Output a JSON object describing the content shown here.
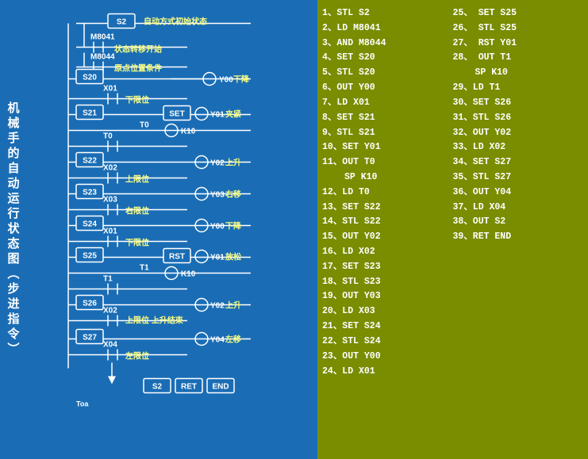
{
  "leftPanel": {
    "title": "机械手的自动运行状态图（步进指令）",
    "bgColor": "#1a6db5"
  },
  "rightPanel": {
    "bgColor": "#7a8c00",
    "col1": [
      "1、STL  S2",
      "2、LD   M8041",
      "3、AND M8044",
      "4、SET  S20",
      "5、STL  S20",
      "6、OUT  Y00",
      "7、LD   X01",
      "8、SET  S21",
      "9、STL  S21",
      "10、SET Y01",
      "11、OUT T0",
      "    SP K10",
      "12、LD  T0",
      "13、SET S22",
      "14、STL S22",
      "15、OUT Y02",
      "16、LD  X02",
      "17、SET S23",
      "18、STL S23",
      "19、OUT Y03",
      "20、LD  X03",
      "21、SET S24",
      "22、STL S24",
      "23、OUT Y00",
      "24、LD  X01"
    ],
    "col2": [
      "25、 SET S25",
      "26、 STL S25",
      "27、 RST  Y01",
      "28、 OUT  T1",
      "      SP K10",
      "29、LD  T1",
      "30、SET S26",
      "31、STL  S26",
      "32、OUT Y02",
      "33、LD    X02",
      "34、SET S27",
      "35、STL  S27",
      "36、OUT Y04",
      "37、LD  X04",
      "38、OUT S2",
      "39、RET  END"
    ]
  }
}
